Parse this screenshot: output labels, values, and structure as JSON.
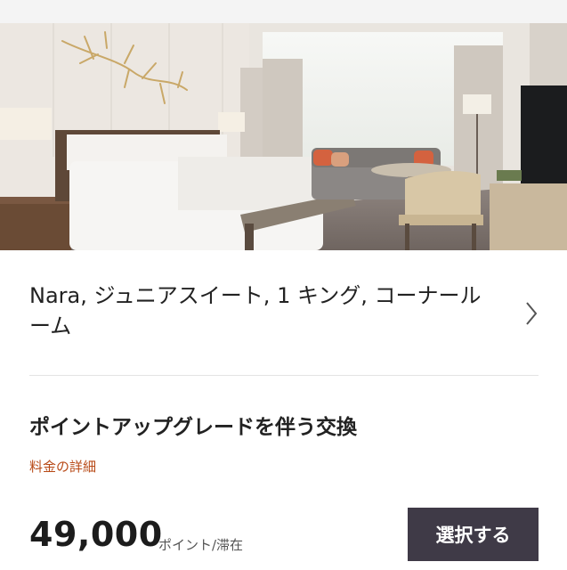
{
  "room": {
    "title": "Nara, ジュニアスイート, 1 キング, コーナールーム",
    "photo_icon": "hotel-room-photo"
  },
  "offer": {
    "title": "ポイントアップグレードを伴う交換",
    "rate_details_link": "料金の詳細",
    "points": "49,000",
    "points_unit": "ポイント/滞在",
    "select_button": "選択する"
  },
  "colors": {
    "accent_link": "#b84a17",
    "button_bg": "#3f3a47"
  }
}
